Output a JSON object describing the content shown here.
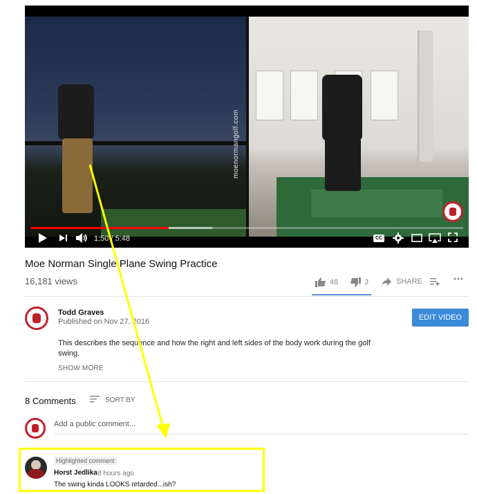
{
  "player": {
    "time_display": "1:50 / 5:48",
    "watermark": "moenormangolf.com",
    "progress_played_fraction": 0.32,
    "progress_buffered_fraction": 0.42,
    "controls": {
      "play_icon": "play-icon",
      "next_icon": "next-icon",
      "volume_icon": "volume-icon",
      "cc_label": "CC",
      "settings_icon": "gear-icon",
      "theater_icon": "theater-icon",
      "airplay_icon": "airplay-icon",
      "fullscreen_icon": "fullscreen-icon"
    }
  },
  "video": {
    "title": "Moe Norman Single Plane Swing Practice",
    "views": "16,181 views",
    "likes": "48",
    "dislikes": "3",
    "share_label": "SHARE",
    "add_to_icon": "add-to-playlist-icon",
    "more_icon": "more-icon"
  },
  "channel": {
    "name": "Todd Graves",
    "published": "Published on Nov 27, 2016",
    "edit_button": "EDIT VIDEO",
    "description": "This describes the sequence and how the right and left sides of the body work during the golf swing.",
    "show_more": "SHOW MORE"
  },
  "comments": {
    "count_label": "8 Comments",
    "sort_label": "SORT BY",
    "add_placeholder": "Add a public comment...",
    "highlighted": {
      "badge": "Highlighted comment",
      "author": "Horst Jedlika",
      "time": "8 hours ago",
      "text": "The swing kinda LOOKS retarded...ish?"
    }
  },
  "colors": {
    "accent_blue": "#3b8ad9",
    "annotation_yellow": "#ffff00",
    "progress_red": "#ff0000",
    "brand_red": "#c0202a"
  }
}
